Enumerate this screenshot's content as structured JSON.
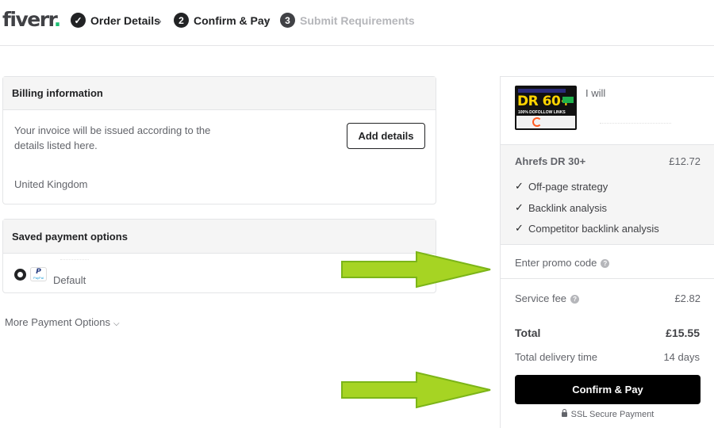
{
  "header": {
    "logo": "fiverr",
    "logo_dot": ".",
    "steps": [
      {
        "num": "✓",
        "label": "Order Details"
      },
      {
        "num": "2",
        "label": "Confirm & Pay"
      },
      {
        "num": "3",
        "label": "Submit Requirements"
      }
    ],
    "separator": "›"
  },
  "billing": {
    "title": "Billing information",
    "invoice_text": "Your invoice will be issued according to the details listed here.",
    "add_button": "Add details",
    "country": "United Kingdom"
  },
  "payment": {
    "title": "Saved payment options",
    "method_icon_text": "P",
    "method_icon_word": "PayPal",
    "default_label": "Default"
  },
  "more_options": {
    "label": "More Payment Options",
    "chevron": "⌵"
  },
  "summary": {
    "gig_title": "I will",
    "gig_image_text": "DR 60+",
    "gig_image_subtext": "100% DOFOLLOW LINKS",
    "package_name": "Ahrefs DR 30+",
    "package_price": "£12.72",
    "features": [
      "Off-page strategy",
      "Backlink analysis",
      "Competitor backlink analysis"
    ],
    "promo_label": "Enter promo code",
    "service_fee_label": "Service fee",
    "service_fee_value": "£2.82",
    "total_label": "Total",
    "total_value": "£15.55",
    "delivery_label": "Total delivery time",
    "delivery_value": "14 days",
    "confirm_button": "Confirm & Pay",
    "ssl_text": "SSL Secure Payment",
    "help_icon": "?"
  },
  "colors": {
    "brand_green": "#1dbf73",
    "arrow_green": "#a6d423",
    "text_dark": "#404145",
    "button_black": "#000000"
  }
}
